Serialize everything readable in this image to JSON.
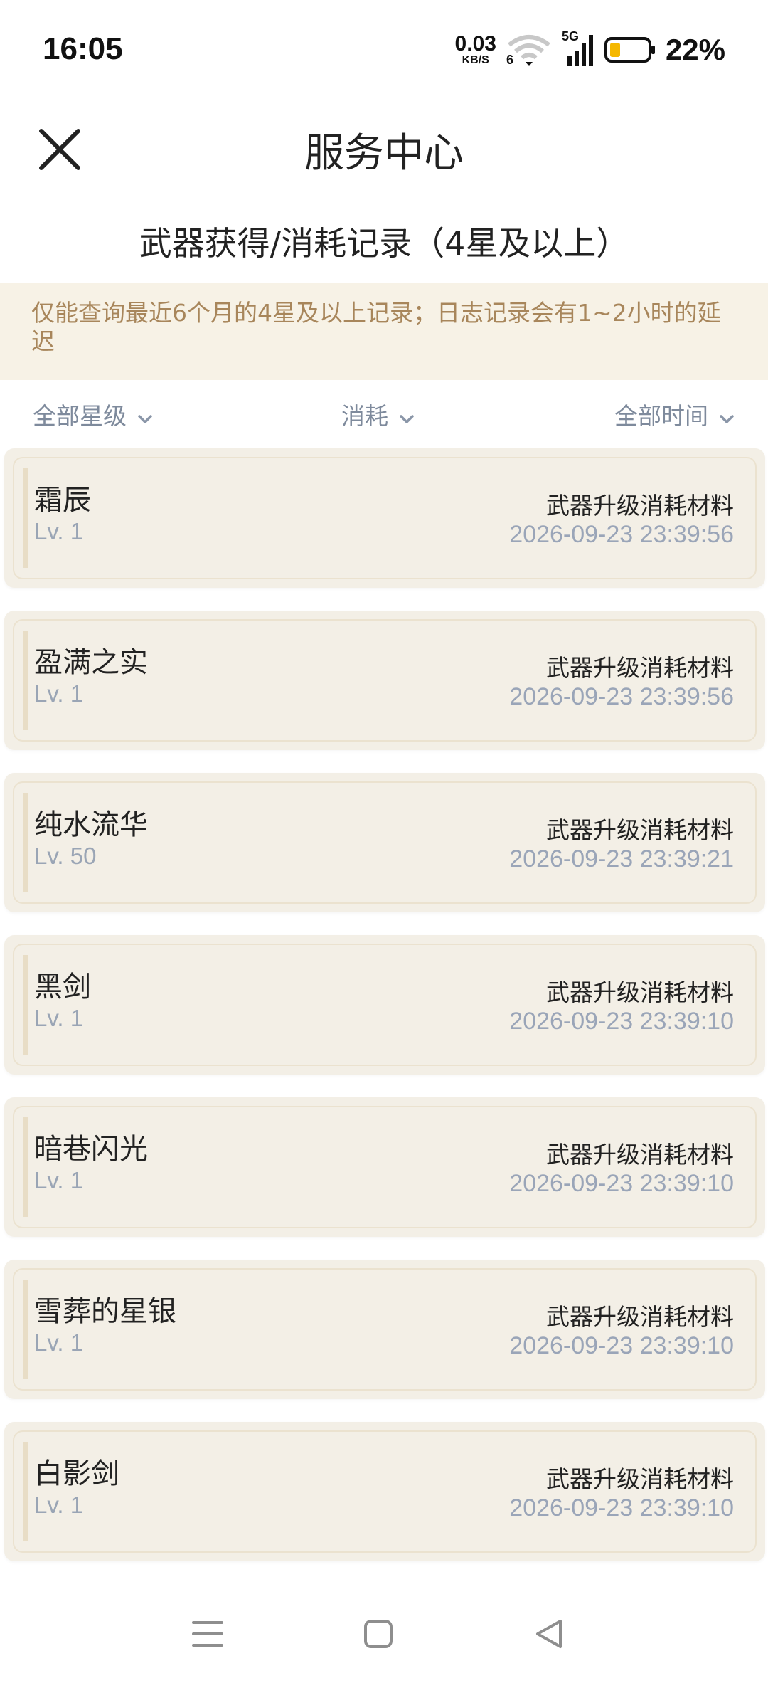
{
  "status_bar": {
    "time": "16:05",
    "net_speed_value": "0.03",
    "net_speed_unit": "KB/S",
    "wifi_label": "6",
    "cell_label": "5G",
    "battery_percent": "22%",
    "battery_color": "#f5b800"
  },
  "header": {
    "title": "服务中心",
    "close_icon": "close-icon"
  },
  "section_title": "武器获得/消耗记录（4星及以上）",
  "notice": "仅能查询最近6个月的4星及以上记录；日志记录会有1~2小时的延迟",
  "filters": {
    "star": "全部星级",
    "type": "消耗",
    "time": "全部时间"
  },
  "records": [
    {
      "name": "霜辰",
      "level": "Lv. 1",
      "reason": "武器升级消耗材料",
      "time": "2026-09-23 23:39:56"
    },
    {
      "name": "盈满之实",
      "level": "Lv. 1",
      "reason": "武器升级消耗材料",
      "time": "2026-09-23 23:39:56"
    },
    {
      "name": "纯水流华",
      "level": "Lv. 50",
      "reason": "武器升级消耗材料",
      "time": "2026-09-23 23:39:21"
    },
    {
      "name": "黑剑",
      "level": "Lv. 1",
      "reason": "武器升级消耗材料",
      "time": "2026-09-23 23:39:10"
    },
    {
      "name": "暗巷闪光",
      "level": "Lv. 1",
      "reason": "武器升级消耗材料",
      "time": "2026-09-23 23:39:10"
    },
    {
      "name": "雪葬的星银",
      "level": "Lv. 1",
      "reason": "武器升级消耗材料",
      "time": "2026-09-23 23:39:10"
    },
    {
      "name": "白影剑",
      "level": "Lv. 1",
      "reason": "武器升级消耗材料",
      "time": "2026-09-23 23:39:10"
    }
  ],
  "colors": {
    "notice_bg": "#f7f2e6",
    "notice_text": "#a8865b",
    "card_bg": "#f3efe6",
    "filter_text": "#7e8a9c"
  }
}
